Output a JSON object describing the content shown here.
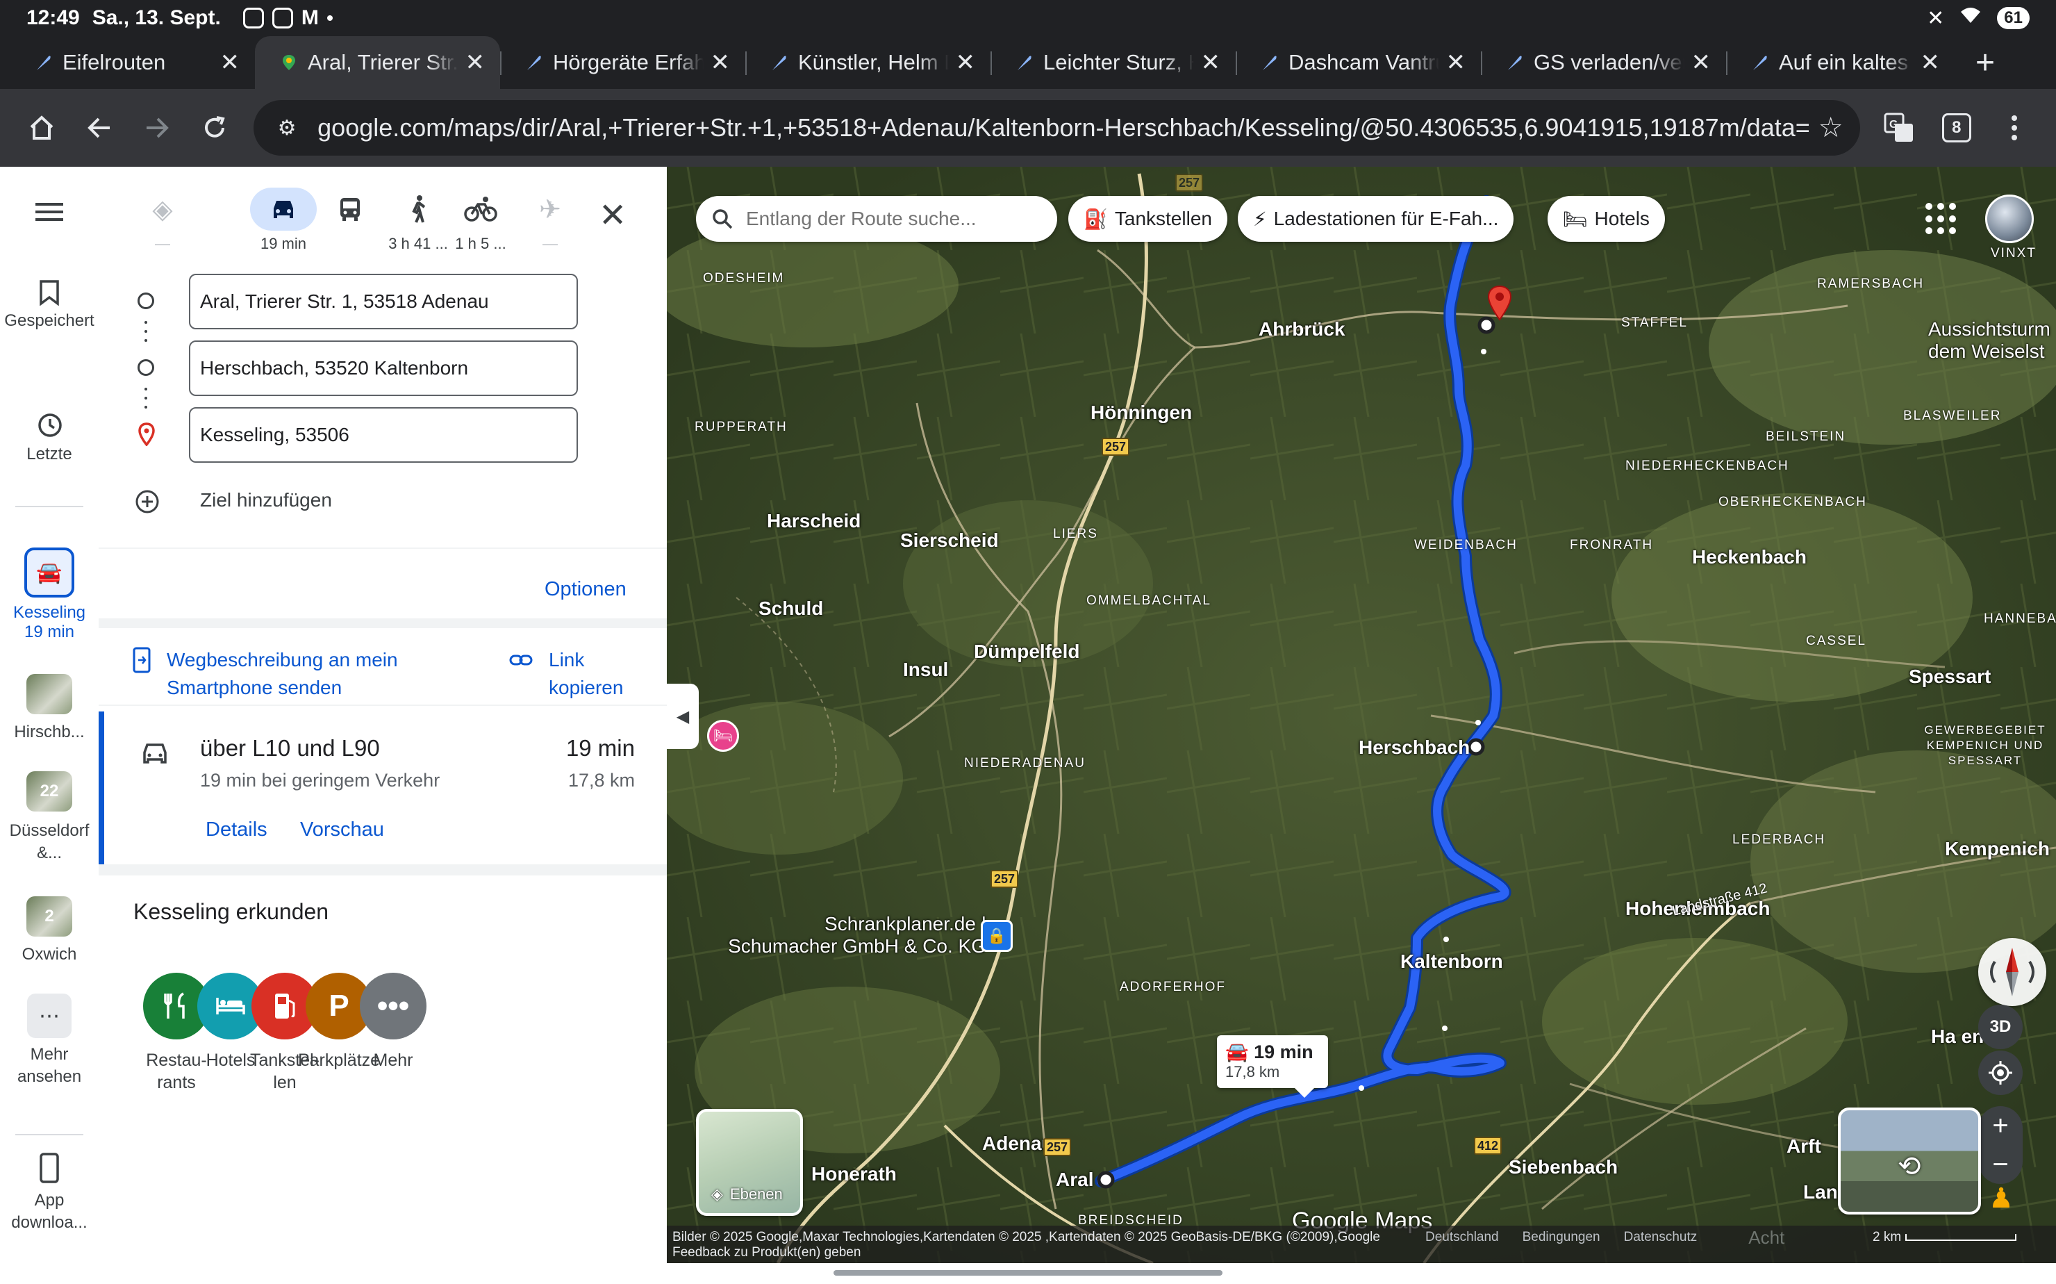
{
  "status": {
    "time": "12:49",
    "date": "Sa., 13. Sept.",
    "battery": "61"
  },
  "tabs": [
    {
      "label": "Eifelrouten",
      "active": false
    },
    {
      "label": "Aral, Trierer Str.",
      "active": true
    },
    {
      "label": "Hörgeräte Erfah",
      "active": false
    },
    {
      "label": "Künstler, Helm D",
      "active": false
    },
    {
      "label": "Leichter Sturz, H",
      "active": false
    },
    {
      "label": "Dashcam Vantru",
      "active": false
    },
    {
      "label": "GS verladen/ver",
      "active": false
    },
    {
      "label": "Auf ein kaltes Bi",
      "active": false
    }
  ],
  "toolbar": {
    "url": "google.com/maps/dir/Aral,+Trierer+Str.+1,+53518+Adenau/Kaltenborn-Herschbach/Kesseling/@50.4306535,6.9041915,19187m/data=",
    "tab_count": "8"
  },
  "rail": {
    "saved": "Gespeichert",
    "recent": "Letzte",
    "items": [
      {
        "label": "Kesseling",
        "sub": "19 min"
      },
      {
        "label": "Hirschb...",
        "sub": ""
      },
      {
        "label": "Düsseldorf &...",
        "sub": "",
        "badge": "22"
      },
      {
        "label": "Oxwich",
        "sub": "",
        "badge": "2"
      },
      {
        "label": "Mehr ansehen",
        "sub": ""
      }
    ],
    "app_download": "App downloa..."
  },
  "modes": [
    {
      "name": "best",
      "label": "—"
    },
    {
      "name": "car",
      "label": "19 min"
    },
    {
      "name": "transit",
      "label": ""
    },
    {
      "name": "walk",
      "label": "3 h 41 ..."
    },
    {
      "name": "bike",
      "label": "1 h 5 ..."
    },
    {
      "name": "flight",
      "label": "—"
    }
  ],
  "waypoints": [
    "Aral, Trierer Str. 1, 53518 Adenau",
    "Herschbach, 53520 Kaltenborn",
    "Kesseling, 53506"
  ],
  "add_destination": "Ziel hinzufügen",
  "options": "Optionen",
  "share": {
    "send": "Wegbeschreibung an mein Smartphone senden",
    "copy": "Link kopieren"
  },
  "route": {
    "title": "über L10 und L90",
    "time": "19 min",
    "traffic": "19 min bei geringem Verkehr",
    "distance": "17,8 km",
    "details": "Details",
    "preview": "Vorschau"
  },
  "explore": {
    "title": "Kesseling erkunden",
    "categories": [
      {
        "label": "Restau-\nrants",
        "color": "#188038",
        "icon": "fork-knife-icon"
      },
      {
        "label": "Hotels",
        "color": "#129eaf",
        "icon": "bed-icon"
      },
      {
        "label": "Tankstel-\nlen",
        "color": "#d93025",
        "icon": "fuel-icon"
      },
      {
        "label": "Parkplätze",
        "color": "#b06000",
        "icon": "parking-icon"
      },
      {
        "label": "Mehr",
        "color": "#70757a",
        "icon": "more-icon"
      }
    ]
  },
  "map": {
    "search_placeholder": "Entlang der Route suche...",
    "chips": [
      "Tankstellen",
      "Ladestationen für E-Fah...",
      "Hotels"
    ],
    "route_badge": {
      "time": "19 min",
      "distance": "17,8 km"
    },
    "layers": "Ebenen",
    "btn3d": "3D",
    "logo": "Google Maps",
    "places_big": [
      "Ahrbrück",
      "Hönningen",
      "Harscheid",
      "Sierscheid",
      "Schuld",
      "Dümpelfeld",
      "Insul",
      "Herschbach",
      "Heckenbach",
      "Kaltenborn",
      "Adenau",
      "Aral",
      "Honerath",
      "Siebenbach",
      "Spessart",
      "Kempenich",
      "Hohenleimbach",
      "Aussichtsturm dem Weiselst",
      "Schrankplaner.de | Schumacher GmbH & Co. KG",
      "Arft",
      "Lan",
      "Ha    en"
    ],
    "places_small": [
      "ODESHEIM",
      "RUPPERATH",
      "LIERS",
      "OMMELBACHTAL",
      "NIEDERADENAU",
      "ADORFERHOF",
      "BREIDSCHEID",
      "WEIDENBACH",
      "FRONRATH",
      "NIEDERHECKENBACH",
      "OBERHECKENBACH",
      "BEILSTEIN",
      "BLASWEILER",
      "STAFFEL",
      "RAMERSBACH",
      "VINXT",
      "HANNEBAC",
      "CASSEL",
      "GEWERBEGEBIET KEMPENICH UND SPESSART",
      "LEDERBACH",
      "Landstraße 412"
    ],
    "road_shields": [
      "257",
      "257",
      "257",
      "257",
      "412"
    ],
    "attribution": "Bilder © 2025 Google,Maxar Technologies,Kartendaten © 2025 ,Kartendaten © 2025 GeoBasis-DE/BKG (©2009),Google",
    "feedback": "Feedback zu Produkt(en) geben",
    "links": [
      "Deutschland",
      "Bedingungen",
      "Datenschutz"
    ],
    "scale": "2 km",
    "faded": "Acht"
  }
}
